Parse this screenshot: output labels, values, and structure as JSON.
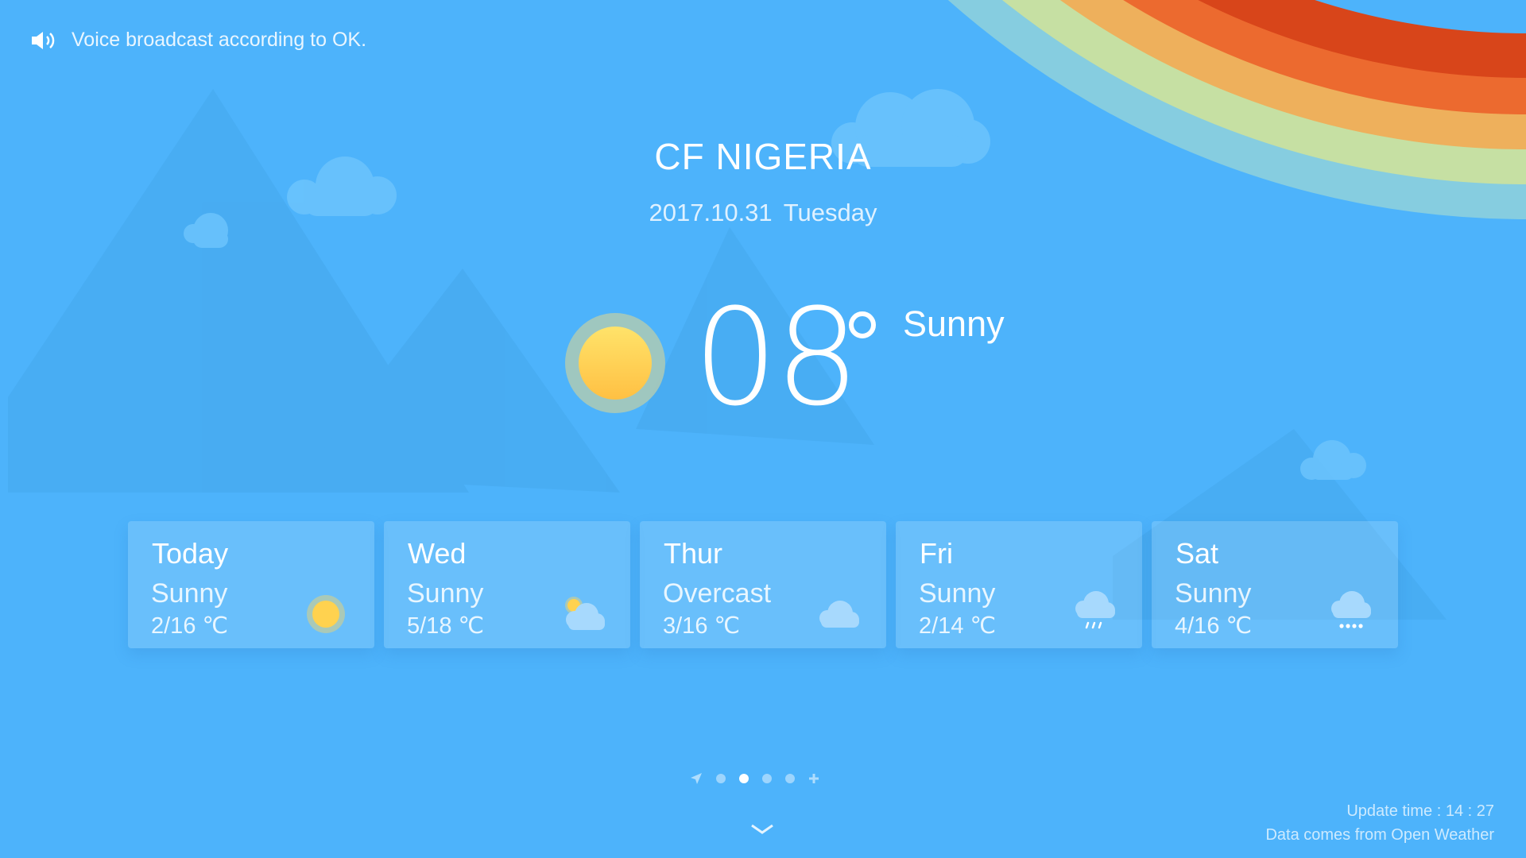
{
  "voice": {
    "icon": "speaker-icon",
    "text": "Voice broadcast according to OK."
  },
  "location": {
    "city": "CF NIGERIA",
    "date": "2017.10.31  Tuesday"
  },
  "current": {
    "icon": "sun-icon",
    "temperature": "08",
    "condition": "Sunny"
  },
  "forecast": [
    {
      "day": "Today",
      "condition": "Sunny",
      "range": "2/16 ℃",
      "icon": "sun-icon"
    },
    {
      "day": "Wed",
      "condition": "Sunny",
      "range": "5/18 ℃",
      "icon": "partly-cloudy-icon"
    },
    {
      "day": "Thur",
      "condition": "Overcast",
      "range": "3/16 ℃",
      "icon": "cloud-icon"
    },
    {
      "day": "Fri",
      "condition": "Sunny",
      "range": "2/14 ℃",
      "icon": "rain-cloud-icon"
    },
    {
      "day": "Sat",
      "condition": "Sunny",
      "range": "4/16 ℃",
      "icon": "snow-cloud-icon"
    }
  ],
  "pager": {
    "count": 4,
    "active_index": 1,
    "left_icon": "location-arrow-icon",
    "right_icon": "add-icon"
  },
  "footer": {
    "update_time": "Update time : 14 : 27",
    "source": "Data comes from Open Weather"
  },
  "colors": {
    "background": "#4db3fb",
    "rainbow": [
      "#d8451a",
      "#ec6a2f",
      "#eeb05c",
      "#c6e0a3",
      "#86cde0"
    ]
  }
}
